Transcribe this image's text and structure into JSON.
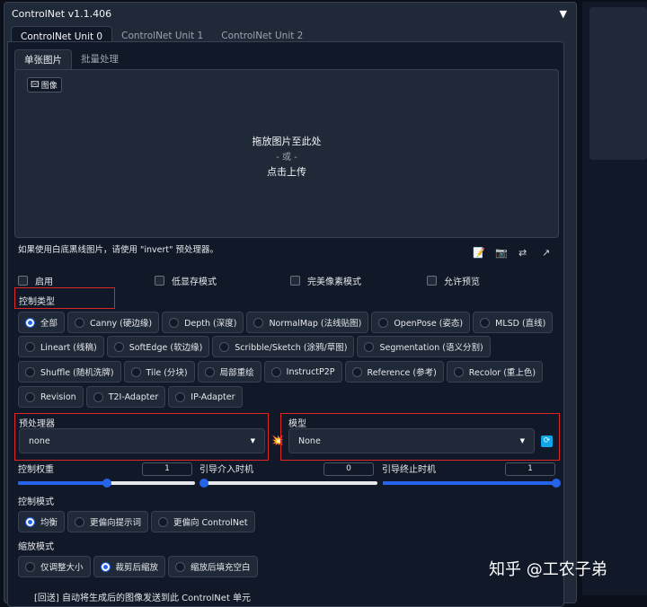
{
  "title": "ControlNet v1.1.406",
  "collapse_icon": "▼",
  "unit_tabs": [
    "ControlNet Unit 0",
    "ControlNet Unit 1",
    "ControlNet Unit 2"
  ],
  "image_tabs": [
    "单张图片",
    "批量处理"
  ],
  "image_label": "图像",
  "drop_text": {
    "line1": "拖放图片至此处",
    "line2": "- 或 -",
    "line3": "点击上传"
  },
  "hint": "如果使用白底黑线图片，请使用 \"invert\" 预处理器。",
  "tool_icons": {
    "edit": "📝",
    "camera": "📷",
    "swap": "⇄",
    "send": "↗"
  },
  "checkboxes": [
    "启用",
    "低显存模式",
    "完美像素模式",
    "允许预览"
  ],
  "control_type": {
    "label": "控制类型",
    "selected": "全部",
    "rows": [
      [
        "全部",
        "Canny (硬边缘)",
        "Depth (深度)",
        "NormalMap (法线贴图)",
        "OpenPose (姿态)",
        "MLSD (直线)"
      ],
      [
        "Lineart (线稿)",
        "SoftEdge (软边缘)",
        "Scribble/Sketch (涂鸦/草图)",
        "Segmentation (语义分割)"
      ],
      [
        "Shuffle (随机洗牌)",
        "Tile (分块)",
        "局部重绘",
        "InstructP2P",
        "Reference (参考)",
        "Recolor (重上色)"
      ],
      [
        "Revision",
        "T2I-Adapter",
        "IP-Adapter"
      ]
    ]
  },
  "preprocessor": {
    "label": "预处理器",
    "value": "none"
  },
  "model": {
    "label": "模型",
    "value": "None"
  },
  "sliders": {
    "weight": {
      "label": "控制权重",
      "value": "1",
      "fraction": 0.5
    },
    "start": {
      "label": "引导介入时机",
      "value": "0",
      "fraction": 0
    },
    "end": {
      "label": "引导终止时机",
      "value": "1",
      "fraction": 1
    }
  },
  "control_mode": {
    "label": "控制模式",
    "options": [
      "均衡",
      "更偏向提示词",
      "更偏向 ControlNet"
    ],
    "selected": "均衡"
  },
  "resize_mode": {
    "label": "缩放模式",
    "options": [
      "仅调整大小",
      "裁剪后缩放",
      "缩放后填充空白"
    ],
    "selected": "裁剪后缩放"
  },
  "footer": "[回送] 自动将生成后的图像发送到此 ControlNet 单元",
  "watermark": "知乎 @工农子弟",
  "colors": {
    "accent": "#2563eb",
    "highlight": "#dc2626"
  }
}
